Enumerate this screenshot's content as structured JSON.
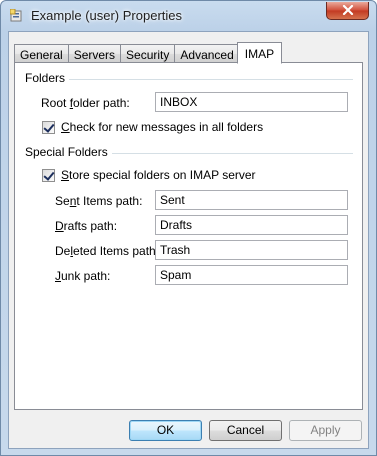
{
  "window": {
    "title": "Example (user) Properties",
    "close_icon": "close-x-icon"
  },
  "tabs": [
    {
      "label": "General"
    },
    {
      "label": "Servers"
    },
    {
      "label": "Security"
    },
    {
      "label": "Advanced"
    },
    {
      "label": "IMAP"
    }
  ],
  "active_tab": "IMAP",
  "folders": {
    "group_label": "Folders",
    "root_path_label": "Root folder path:",
    "root_path_value": "INBOX",
    "check_all_label": "Check for new messages in all folders",
    "check_all_checked": true
  },
  "special": {
    "group_label": "Special Folders",
    "store_label": "Store special folders on IMAP server",
    "store_checked": true,
    "fields": [
      {
        "label": "Sent Items path:",
        "value": "Sent"
      },
      {
        "label": "Drafts path:",
        "value": "Drafts"
      },
      {
        "label": "Deleted Items path:",
        "value": "Trash"
      },
      {
        "label": "Junk path:",
        "value": "Spam"
      }
    ]
  },
  "buttons": {
    "ok": "OK",
    "cancel": "Cancel",
    "apply": "Apply"
  }
}
